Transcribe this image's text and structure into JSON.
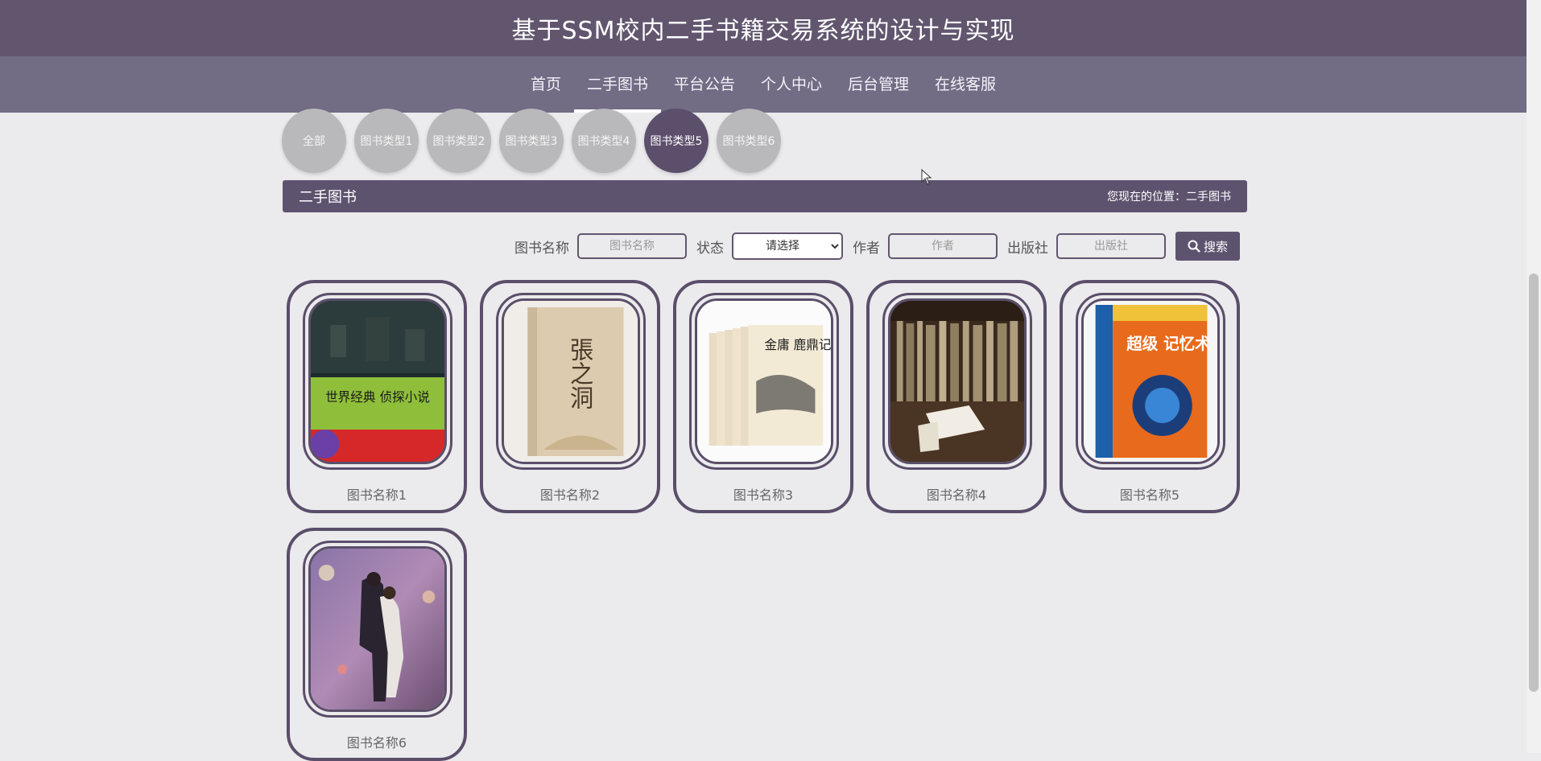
{
  "header": {
    "title": "基于SSM校内二手书籍交易系统的设计与实现"
  },
  "nav": {
    "items": [
      {
        "label": "首页"
      },
      {
        "label": "二手图书",
        "active": true
      },
      {
        "label": "平台公告"
      },
      {
        "label": "个人中心"
      },
      {
        "label": "后台管理"
      },
      {
        "label": "在线客服"
      }
    ]
  },
  "categories": {
    "items": [
      {
        "label": "全部"
      },
      {
        "label": "图书类型1"
      },
      {
        "label": "图书类型2"
      },
      {
        "label": "图书类型3"
      },
      {
        "label": "图书类型4"
      },
      {
        "label": "图书类型5",
        "active": true
      },
      {
        "label": "图书类型6"
      }
    ]
  },
  "section": {
    "title": "二手图书",
    "breadcrumb": "您现在的位置：二手图书"
  },
  "search": {
    "name_label": "图书名称",
    "name_placeholder": "图书名称",
    "status_label": "状态",
    "status_selected": "请选择",
    "author_label": "作者",
    "author_placeholder": "作者",
    "publisher_label": "出版社",
    "publisher_placeholder": "出版社",
    "button_label": "搜索"
  },
  "books": [
    {
      "name": "图书名称1",
      "cover_text": "世界经典 侦探小说"
    },
    {
      "name": "图书名称2",
      "cover_text": "張之洞"
    },
    {
      "name": "图书名称3",
      "cover_text": "金庸 鹿鼎记"
    },
    {
      "name": "图书名称4",
      "cover_text": ""
    },
    {
      "name": "图书名称5",
      "cover_text": "超级 记忆术"
    },
    {
      "name": "图书名称6",
      "cover_text": ""
    }
  ],
  "colors": {
    "header_bg": "#62566f",
    "nav_bg": "#726c85",
    "accent": "#5e536f",
    "page_bg": "#ebeaec"
  }
}
